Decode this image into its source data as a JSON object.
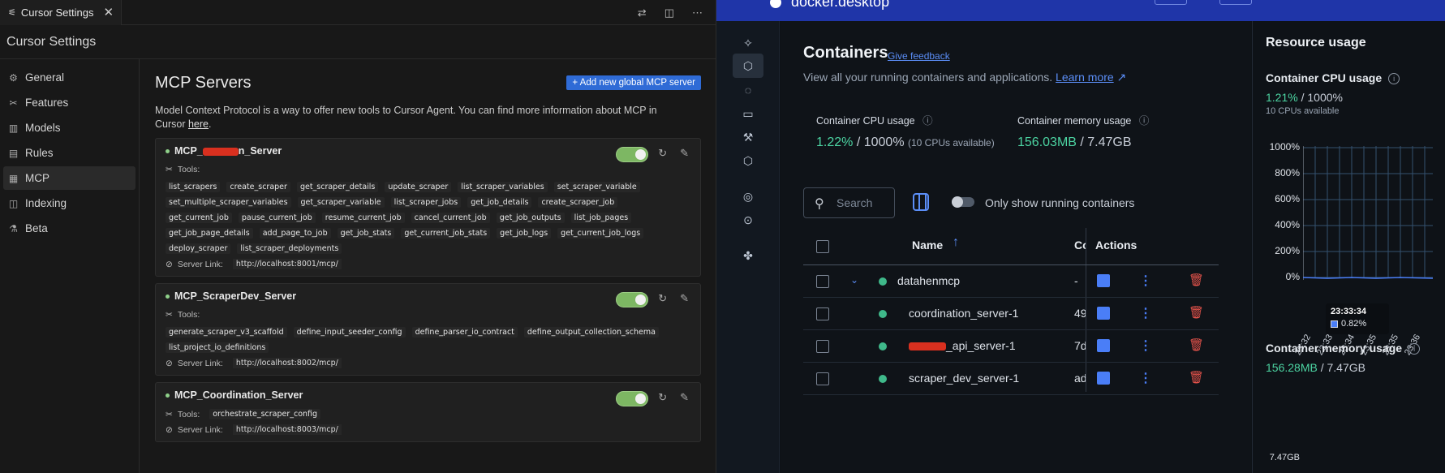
{
  "cursor": {
    "tab_title": "Cursor Settings",
    "settings_title": "Cursor Settings",
    "nav": [
      {
        "label": "General",
        "icon": "gear-icon",
        "glyph": "⚙",
        "active": false
      },
      {
        "label": "Features",
        "icon": "tools-icon",
        "glyph": "✂",
        "active": false
      },
      {
        "label": "Models",
        "icon": "chart-icon",
        "glyph": "▥",
        "active": false
      },
      {
        "label": "Rules",
        "icon": "book-icon",
        "glyph": "▤",
        "active": false
      },
      {
        "label": "MCP",
        "icon": "server-icon",
        "glyph": "▦",
        "active": true
      },
      {
        "label": "Indexing",
        "icon": "database-icon",
        "glyph": "◫",
        "active": false
      },
      {
        "label": "Beta",
        "icon": "flask-icon",
        "glyph": "⚗",
        "active": false
      }
    ],
    "heading": "MCP Servers",
    "add_button": "+ Add new global MCP server",
    "description": "Model Context Protocol is a way to offer new tools to Cursor Agent. You can find more information about MCP in Cursor ",
    "description_link": "here",
    "description_end": ".",
    "tools_label": "Tools:",
    "server_link_label": "Server Link:",
    "servers": [
      {
        "name_prefix": "MCP_",
        "name_suffix": "n_Server",
        "redacted": true,
        "enabled": true,
        "tools": [
          "list_scrapers",
          "create_scraper",
          "get_scraper_details",
          "update_scraper",
          "list_scraper_variables",
          "set_scraper_variable",
          "set_multiple_scraper_variables",
          "get_scraper_variable",
          "list_scraper_jobs",
          "get_job_details",
          "create_scraper_job",
          "get_current_job",
          "pause_current_job",
          "resume_current_job",
          "cancel_current_job",
          "get_job_outputs",
          "list_job_pages",
          "get_job_page_details",
          "add_page_to_job",
          "get_job_stats",
          "get_current_job_stats",
          "get_job_logs",
          "get_current_job_logs",
          "deploy_scraper",
          "list_scraper_deployments"
        ],
        "link": "http://localhost:8001/mcp/"
      },
      {
        "name_prefix": "MCP_ScraperDev_Server",
        "name_suffix": "",
        "redacted": false,
        "enabled": true,
        "tools": [
          "generate_scraper_v3_scaffold",
          "define_input_seeder_config",
          "define_parser_io_contract",
          "define_output_collection_schema",
          "list_project_io_definitions"
        ],
        "link": "http://localhost:8002/mcp/"
      },
      {
        "name_prefix": "MCP_Coordination_Server",
        "name_suffix": "",
        "redacted": false,
        "enabled": true,
        "tools": [
          "orchestrate_scraper_config"
        ],
        "link": "http://localhost:8003/mcp/"
      }
    ]
  },
  "docker": {
    "title": "Containers",
    "feedback": "Give feedback",
    "subtitle": "View all your running containers and applications.",
    "learn_more": "Learn more",
    "cpu_label": "Container CPU usage",
    "cpu_value": "1.22%",
    "cpu_total": "/ 1000%",
    "cpu_note": "(10 CPUs available)",
    "mem_label": "Container memory usage",
    "mem_value": "156.03MB",
    "mem_total": "/ 7.47GB",
    "search_placeholder": "Search",
    "running_toggle_label": "Only show running containers",
    "columns": {
      "name": "Name",
      "cc": "Co",
      "actions": "Actions"
    },
    "rows": [
      {
        "name": "datahenmcp",
        "cc": "-",
        "group": true,
        "redacted": false
      },
      {
        "name": "coordination_server-1",
        "cc": "49",
        "group": false,
        "redacted": false
      },
      {
        "name": "_api_server-1",
        "cc": "7d",
        "group": false,
        "redacted": true
      },
      {
        "name": "scraper_dev_server-1",
        "cc": "ad",
        "group": false,
        "redacted": false
      }
    ],
    "resource": {
      "title": "Resource usage",
      "cpu_title": "Container CPU usage",
      "cpu_value": "1.21%",
      "cpu_total": "/ 1000%",
      "cpu_note": "10 CPUs available",
      "y_ticks": [
        "1000%",
        "800%",
        "600%",
        "400%",
        "200%",
        "0%"
      ],
      "x_ticks": [
        "23:32",
        "23:33",
        "23:34",
        "23:35",
        "23:35",
        "23:36"
      ],
      "tooltip_time": "23:33:34",
      "tooltip_value": "0.82%",
      "mem_title": "Container memory usage",
      "mem_value": "156.28MB",
      "mem_total": "/ 7.47GB",
      "mem_tick": "7.47GB"
    }
  }
}
